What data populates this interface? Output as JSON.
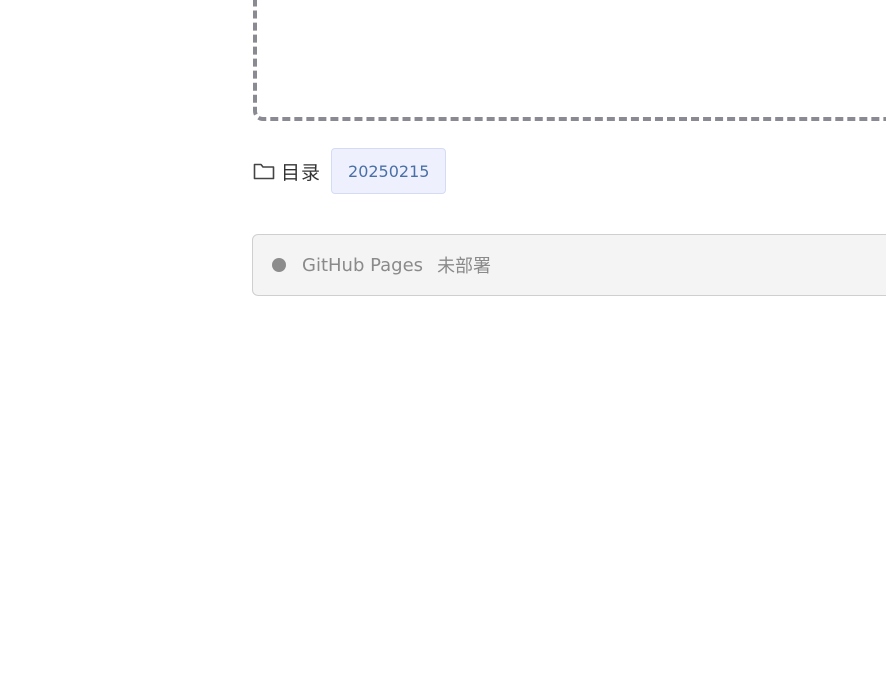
{
  "directory": {
    "icon": "folder-icon",
    "label": "目录",
    "chip": "20250215"
  },
  "deploy": {
    "name": "GitHub Pages",
    "status": "未部署",
    "status_color": "#8c8c8c"
  },
  "colors": {
    "dashed_border": "#8a8a92",
    "chip_bg": "#eef1fd",
    "chip_text": "#4a6fa8",
    "bar_bg": "#f4f4f4"
  }
}
